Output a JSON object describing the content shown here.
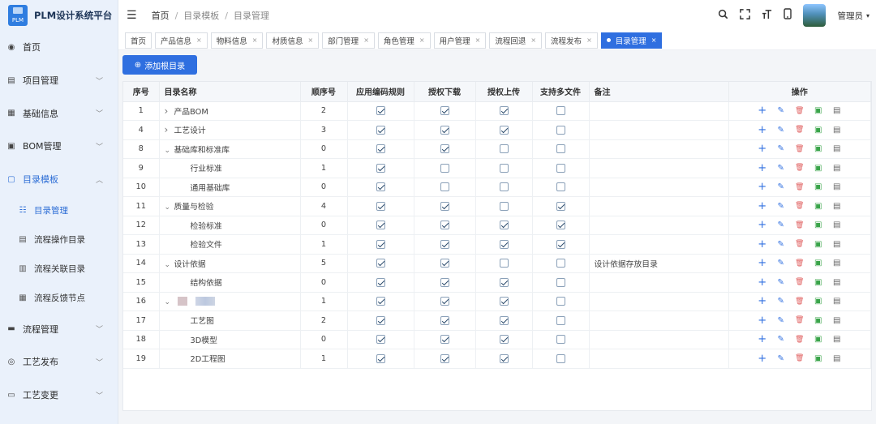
{
  "brand": {
    "title": "PLM设计系统平台",
    "logo_text": "PLM"
  },
  "sidebar": {
    "items": [
      {
        "label": "首页",
        "icon": "dashboard-icon",
        "glyph": "◉",
        "has_chevron": false,
        "open": false
      },
      {
        "label": "项目管理",
        "icon": "project-icon",
        "glyph": "▤",
        "has_chevron": true,
        "open": false
      },
      {
        "label": "基础信息",
        "icon": "info-icon",
        "glyph": "▦",
        "has_chevron": true,
        "open": false
      },
      {
        "label": "BOM管理",
        "icon": "bom-icon",
        "glyph": "▣",
        "has_chevron": true,
        "open": false
      },
      {
        "label": "目录模板",
        "icon": "template-icon",
        "glyph": "▢",
        "has_chevron": true,
        "open": true
      }
    ],
    "sub_items": [
      {
        "label": "目录管理",
        "icon": "catalog-icon",
        "glyph": "☷",
        "active": true
      },
      {
        "label": "流程操作目录",
        "icon": "flow-op-icon",
        "glyph": "▤",
        "active": false
      },
      {
        "label": "流程关联目录",
        "icon": "flow-link-icon",
        "glyph": "▥",
        "active": false
      },
      {
        "label": "流程反馈节点",
        "icon": "flow-feedback-icon",
        "glyph": "▦",
        "active": false
      }
    ],
    "items_after": [
      {
        "label": "流程管理",
        "icon": "process-icon",
        "glyph": "▬",
        "has_chevron": true
      },
      {
        "label": "工艺发布",
        "icon": "publish-icon",
        "glyph": "◎",
        "has_chevron": true
      },
      {
        "label": "工艺变更",
        "icon": "change-icon",
        "glyph": "▭",
        "has_chevron": true
      }
    ]
  },
  "header": {
    "breadcrumb": [
      "首页",
      "目录模板",
      "目录管理"
    ],
    "user_name": "管理员"
  },
  "tags": [
    {
      "label": "首页",
      "closable": false,
      "active": false
    },
    {
      "label": "产品信息",
      "closable": true,
      "active": false
    },
    {
      "label": "物料信息",
      "closable": true,
      "active": false
    },
    {
      "label": "材质信息",
      "closable": true,
      "active": false
    },
    {
      "label": "部门管理",
      "closable": true,
      "active": false
    },
    {
      "label": "角色管理",
      "closable": true,
      "active": false
    },
    {
      "label": "用户管理",
      "closable": true,
      "active": false
    },
    {
      "label": "流程回退",
      "closable": true,
      "active": false
    },
    {
      "label": "流程发布",
      "closable": true,
      "active": false
    },
    {
      "label": "目录管理",
      "closable": true,
      "active": true
    }
  ],
  "toolbar": {
    "add_root_label": "添加根目录"
  },
  "table": {
    "columns": [
      "序号",
      "目录名称",
      "顺序号",
      "应用编码规则",
      "授权下载",
      "授权上传",
      "支持多文件",
      "备注",
      "操作"
    ],
    "rows": [
      {
        "id": "1",
        "name": "产品BOM",
        "level": 0,
        "expander": "›",
        "order": "2",
        "code_rule": true,
        "download": true,
        "upload": true,
        "multi": false,
        "note": ""
      },
      {
        "id": "4",
        "name": "工艺设计",
        "level": 0,
        "expander": "›",
        "order": "3",
        "code_rule": true,
        "download": true,
        "upload": true,
        "multi": false,
        "note": ""
      },
      {
        "id": "8",
        "name": "基础库和标准库",
        "level": 0,
        "expander": "⌄",
        "order": "0",
        "code_rule": true,
        "download": true,
        "upload": false,
        "multi": false,
        "note": ""
      },
      {
        "id": "9",
        "name": "行业标准",
        "level": 1,
        "expander": "",
        "order": "1",
        "code_rule": true,
        "download": false,
        "upload": false,
        "multi": false,
        "note": ""
      },
      {
        "id": "10",
        "name": "通用基础库",
        "level": 1,
        "expander": "",
        "order": "0",
        "code_rule": true,
        "download": false,
        "upload": false,
        "multi": false,
        "note": ""
      },
      {
        "id": "11",
        "name": "质量与检验",
        "level": 0,
        "expander": "⌄",
        "order": "4",
        "code_rule": true,
        "download": true,
        "upload": false,
        "multi": true,
        "note": ""
      },
      {
        "id": "12",
        "name": "检验标准",
        "level": 1,
        "expander": "",
        "order": "0",
        "code_rule": true,
        "download": true,
        "upload": true,
        "multi": true,
        "note": ""
      },
      {
        "id": "13",
        "name": "检验文件",
        "level": 1,
        "expander": "",
        "order": "1",
        "code_rule": true,
        "download": true,
        "upload": true,
        "multi": true,
        "note": ""
      },
      {
        "id": "14",
        "name": "设计依据",
        "level": 0,
        "expander": "⌄",
        "order": "5",
        "code_rule": true,
        "download": true,
        "upload": false,
        "multi": false,
        "note": "设计依据存放目录"
      },
      {
        "id": "15",
        "name": "结构依据",
        "level": 1,
        "expander": "",
        "order": "0",
        "code_rule": true,
        "download": true,
        "upload": true,
        "multi": false,
        "note": ""
      },
      {
        "id": "16",
        "name": "",
        "level": 0,
        "expander": "⌄",
        "blurred": true,
        "order": "1",
        "code_rule": true,
        "download": true,
        "upload": true,
        "multi": false,
        "note": ""
      },
      {
        "id": "17",
        "name": "工艺图",
        "level": 1,
        "expander": "",
        "order": "2",
        "code_rule": true,
        "download": true,
        "upload": true,
        "multi": false,
        "note": ""
      },
      {
        "id": "18",
        "name": "3D模型",
        "level": 1,
        "expander": "",
        "order": "0",
        "code_rule": true,
        "download": true,
        "upload": true,
        "multi": false,
        "note": ""
      },
      {
        "id": "19",
        "name": "2D工程图",
        "level": 1,
        "expander": "",
        "order": "1",
        "code_rule": true,
        "download": true,
        "upload": true,
        "multi": false,
        "note": ""
      }
    ],
    "op_icons": [
      "add-child-icon",
      "edit-icon",
      "delete-icon",
      "save-icon",
      "document-icon"
    ]
  },
  "colors": {
    "primary": "#2f6fe0",
    "sidebar_bg": "#eaf1fb",
    "danger": "#e06060",
    "success": "#3aa44a"
  }
}
